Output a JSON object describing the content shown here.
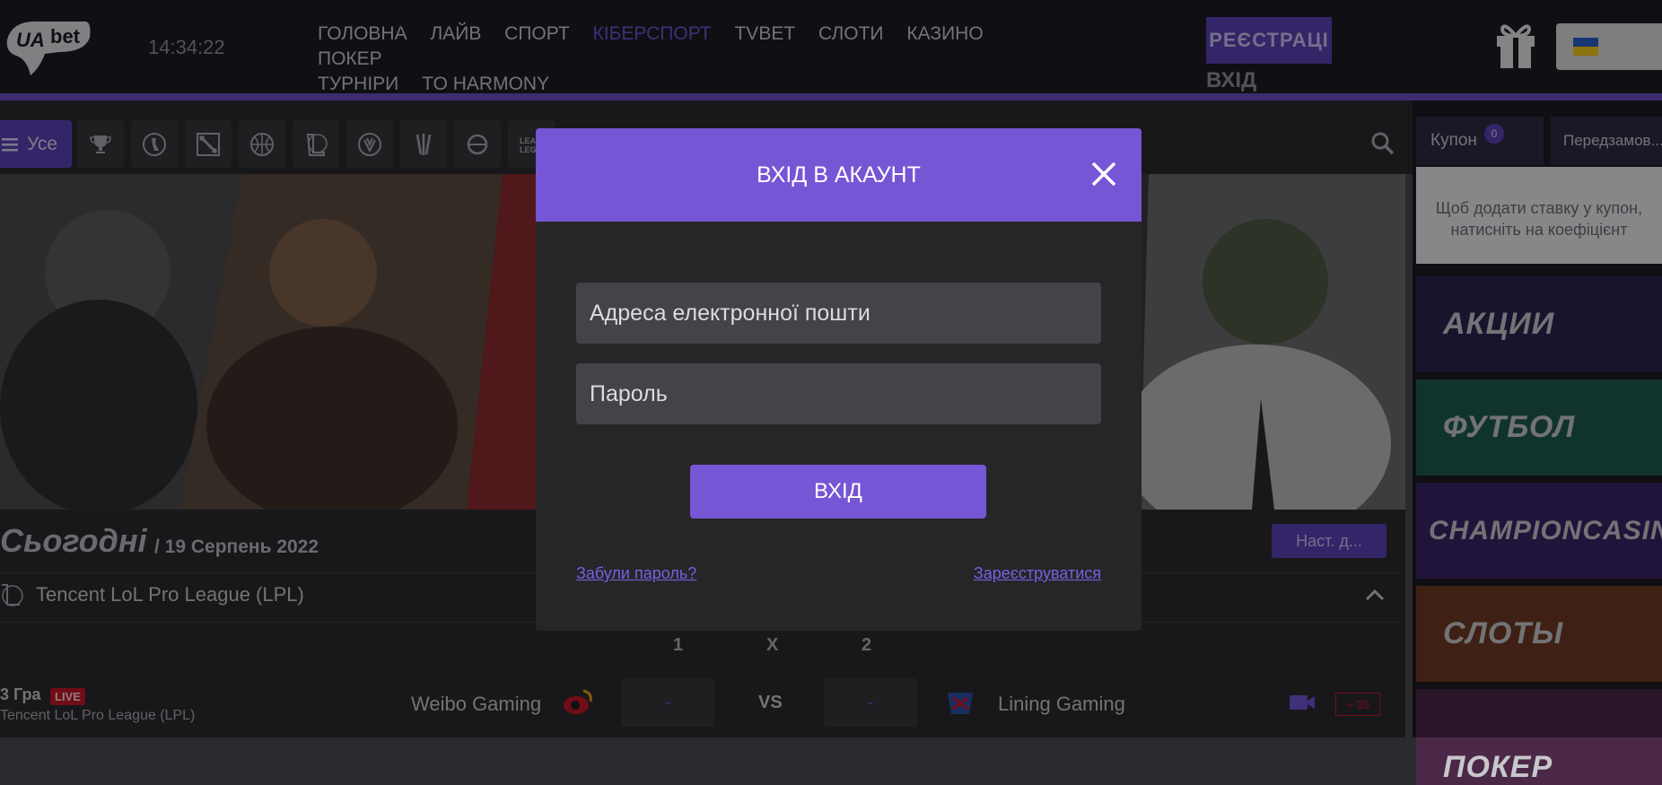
{
  "header": {
    "clock": "14:34:22",
    "nav": [
      "ГОЛОВНА",
      "ЛАЙВ",
      "СПОРТ",
      "КІБЕРСПОРТ",
      "TVBET",
      "СЛОТИ",
      "КАЗИНО",
      "ПОКЕР",
      "ТУРНІРИ",
      "TO HARMONY"
    ],
    "active_nav_index": 3,
    "register_label": "РЕЄСТРАЦІ",
    "login_label": "ВХІД"
  },
  "sportbar": {
    "all_label": "Усе",
    "icons": [
      "trophy-icon",
      "counter-strike-icon",
      "dota-icon",
      "basketball-icon",
      "league-of-legends-icon",
      "overwatch-icon",
      "starcraft-icon",
      "rocket-league-icon",
      "lol-league-logo-icon"
    ]
  },
  "events": {
    "today_label": "Сьогодні",
    "date": "/ 19 Серпень 2022",
    "next_label": "Наст. д...",
    "league": "Tencent LoL Pro League (LPL)",
    "columns": [
      "1",
      "X",
      "2"
    ],
    "match": {
      "game": "3 Гра",
      "live_label": "LIVE",
      "league": "Tencent LoL Pro League (LPL)",
      "team1": "Weibo Gaming",
      "team2": "Lining Gaming",
      "vs": "VS",
      "odd1": "-",
      "odd2": "-",
      "more": "+ 35"
    }
  },
  "sidebar": {
    "coupon_label": "Купон",
    "coupon_count": "0",
    "prebook_label": "Передзамов...",
    "coupon_hint": "Щоб додати ставку у купон, натисніть на коефіцієнт",
    "promos": [
      {
        "label": "АКЦИИ",
        "color": "#2a2350"
      },
      {
        "label": "ФУТБОЛ",
        "color": "#1d5a4a"
      },
      {
        "label": "CHAMPIONCASINO",
        "color": "#3a2466"
      },
      {
        "label": "СЛОТЫ",
        "color": "#6b3a24"
      },
      {
        "label": "ПОКЕР",
        "color": "#4b2848"
      }
    ]
  },
  "modal": {
    "title": "ВХІД В АКАУНТ",
    "email_placeholder": "Адреса електронної пошти",
    "password_placeholder": "Пароль",
    "submit_label": "ВХІД",
    "forgot_label": "Забули пароль?",
    "register_label": "Зареєструватися"
  },
  "colors": {
    "accent": "#7556d4",
    "accent_dark": "#5b40b3",
    "live": "#c3182a"
  }
}
